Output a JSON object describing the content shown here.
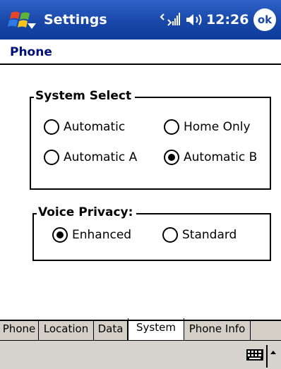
{
  "title_bar": {
    "app_title": "Settings",
    "clock": "12:26",
    "ok_label": "ok",
    "icons": [
      "windows-start-icon",
      "connectivity-icon",
      "volume-icon"
    ]
  },
  "page": {
    "heading": "Phone"
  },
  "system_select": {
    "label": "System Select",
    "options": [
      {
        "label": "Automatic",
        "checked": false
      },
      {
        "label": "Home Only",
        "checked": false
      },
      {
        "label": "Automatic A",
        "checked": false
      },
      {
        "label": "Automatic B",
        "checked": true
      }
    ]
  },
  "voice_privacy": {
    "label": "Voice Privacy:",
    "options": [
      {
        "label": "Enhanced",
        "checked": true
      },
      {
        "label": "Standard",
        "checked": false
      }
    ]
  },
  "tabs": [
    {
      "label": "Phone",
      "active": false
    },
    {
      "label": "Location",
      "active": false
    },
    {
      "label": "Data",
      "active": false
    },
    {
      "label": "System",
      "active": true
    },
    {
      "label": "Phone Info",
      "active": false
    }
  ],
  "command_bar": {
    "icons": [
      "keyboard-icon",
      "sip-arrow-icon"
    ]
  },
  "colors": {
    "title_bar": "#1847a8",
    "heading": "#00107a",
    "command_bar": "#d6d3ce"
  }
}
